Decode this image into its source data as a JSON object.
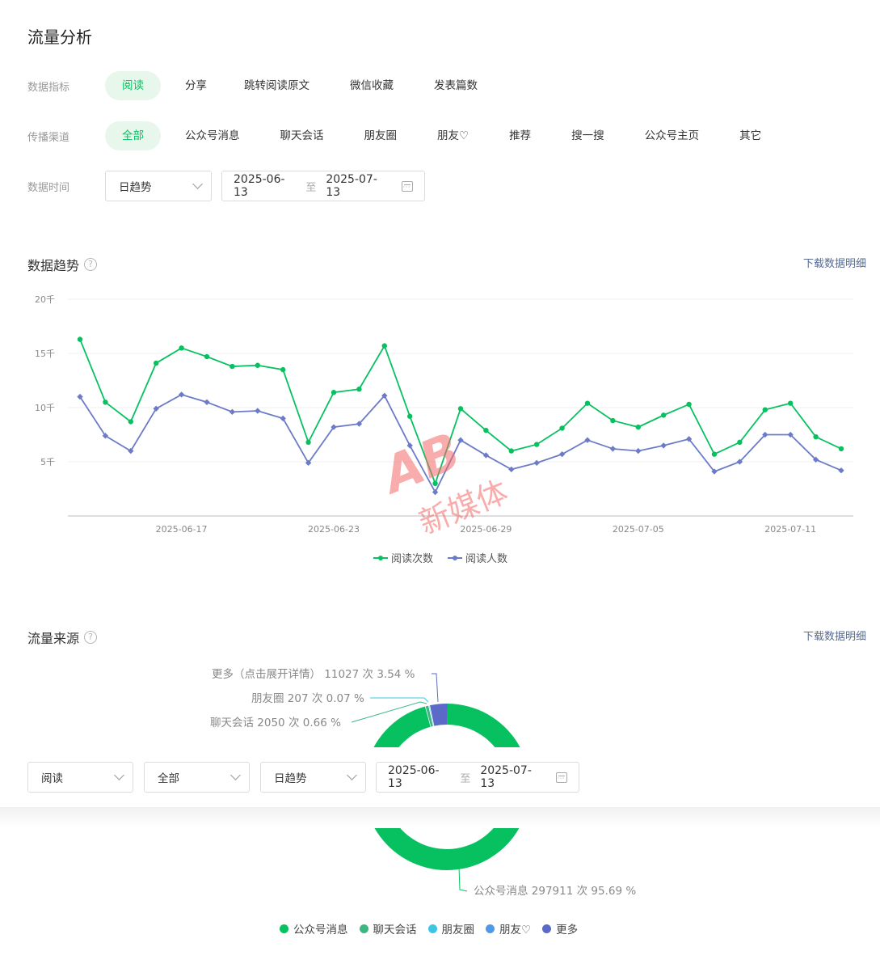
{
  "page_title": "流量分析",
  "filters": {
    "metric_label": "数据指标",
    "metrics": [
      "阅读",
      "分享",
      "跳转阅读原文",
      "微信收藏",
      "发表篇数"
    ],
    "metric_active": 0,
    "channel_label": "传播渠道",
    "channels": [
      "全部",
      "公众号消息",
      "聊天会话",
      "朋友圈",
      "朋友♡",
      "推荐",
      "搜一搜",
      "公众号主页",
      "其它"
    ],
    "channel_active": 0,
    "time_label": "数据时间",
    "granularity": "日趋势",
    "date_from": "2025-06-13",
    "date_sep": "至",
    "date_to": "2025-07-13"
  },
  "trend": {
    "title": "数据趋势",
    "help": "?",
    "download": "下载数据明细"
  },
  "source": {
    "title": "流量来源",
    "help": "?",
    "download": "下载数据明细",
    "labels": {
      "more": "更多（点击展开详情） 11027 次 3.54 %",
      "moments": "朋友圈 207 次 0.07 %",
      "chat": "聊天会话 2050 次 0.66 %",
      "official": "公众号消息 297911 次 95.69 %"
    }
  },
  "floating_bar": {
    "metric": "阅读",
    "channel": "全部",
    "granularity": "日趋势",
    "date_from": "2025-06-13",
    "date_sep": "至",
    "date_to": "2025-07-13"
  },
  "watermark_text": "新媒体",
  "colors": {
    "green": "#07c160",
    "purple": "#6b7bc7",
    "chat": "#3cb782",
    "moments": "#3fc5e3",
    "friends": "#4f9ae8",
    "more": "#5b6ac8",
    "link": "#576b95"
  },
  "chart_data": [
    {
      "type": "line",
      "x": [
        "2025-06-13",
        "2025-06-14",
        "2025-06-15",
        "2025-06-16",
        "2025-06-17",
        "2025-06-18",
        "2025-06-19",
        "2025-06-20",
        "2025-06-21",
        "2025-06-22",
        "2025-06-23",
        "2025-06-24",
        "2025-06-25",
        "2025-06-26",
        "2025-06-27",
        "2025-06-28",
        "2025-06-29",
        "2025-06-30",
        "2025-07-01",
        "2025-07-02",
        "2025-07-03",
        "2025-07-04",
        "2025-07-05",
        "2025-07-06",
        "2025-07-07",
        "2025-07-08",
        "2025-07-09",
        "2025-07-10",
        "2025-07-11",
        "2025-07-12",
        "2025-07-13"
      ],
      "xticks": [
        "2025-06-17",
        "2025-06-23",
        "2025-06-29",
        "2025-07-05",
        "2025-07-11"
      ],
      "yticks": [
        "20千",
        "15千",
        "10千",
        "5千"
      ],
      "ylim": [
        0,
        20000
      ],
      "grid": true,
      "legend": "bottom",
      "series": [
        {
          "name": "阅读次数",
          "values": [
            16300,
            10500,
            8700,
            14100,
            15500,
            14700,
            13800,
            13900,
            13500,
            6800,
            11400,
            11700,
            15700,
            9200,
            3000,
            9900,
            7900,
            6000,
            6600,
            8100,
            10400,
            8800,
            8200,
            9300,
            10300,
            5700,
            6800,
            9800,
            10400,
            7300,
            6200
          ]
        },
        {
          "name": "阅读人数",
          "values": [
            11000,
            7400,
            6000,
            9900,
            11200,
            10500,
            9600,
            9700,
            9000,
            4900,
            8200,
            8500,
            11100,
            6500,
            2200,
            7000,
            5600,
            4300,
            4900,
            5700,
            7000,
            6200,
            6000,
            6500,
            7100,
            4100,
            5000,
            7500,
            7500,
            5200,
            4200
          ]
        }
      ]
    },
    {
      "type": "pie",
      "categories": [
        "公众号消息",
        "聊天会话",
        "朋友圈",
        "朋友♡",
        "更多"
      ],
      "values": [
        297911,
        2050,
        207,
        0,
        11027
      ],
      "percent": [
        95.69,
        0.66,
        0.07,
        0,
        3.54
      ],
      "legend": "bottom"
    }
  ]
}
